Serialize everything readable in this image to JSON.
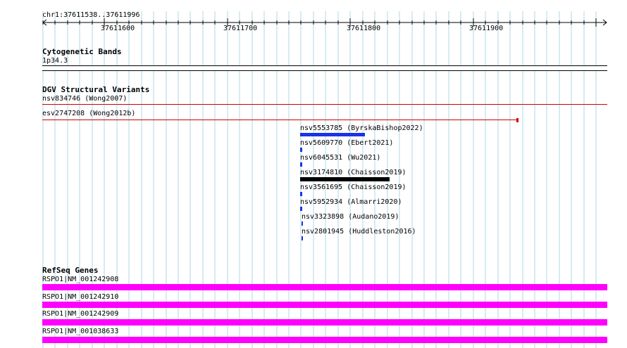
{
  "ruler": {
    "region": "chr1:37611538..37611996",
    "ticks": [
      "37611600",
      "37611700",
      "37611800",
      "37611900"
    ]
  },
  "tracks": {
    "cytobands": {
      "title": "Cytogenetic Bands",
      "band": "1p34.3"
    },
    "dgv": {
      "title": "DGV Structural Variants",
      "variants": [
        {
          "label": "nsv834746 (Wong2007)",
          "color": "#d00000"
        },
        {
          "label": "esv2747208 (Wong2012b)",
          "color": "#d00000"
        },
        {
          "label": "nsv5553785 (ByrskaBishop2022)",
          "color": "#1a33e6"
        },
        {
          "label": "nsv5609770 (Ebert2021)",
          "color": "#1a33e6"
        },
        {
          "label": "nsv6045531 (Wu2021)",
          "color": "#1a33e6"
        },
        {
          "label": "nsv3174810 (Chaisson2019)",
          "color": "#000000"
        },
        {
          "label": "nsv3561695 (Chaisson2019)",
          "color": "#1a33e6"
        },
        {
          "label": "nsv5952934 (Almarri2020)",
          "color": "#1a33e6"
        },
        {
          "label": "nsv3323898 (Audano2019)",
          "color": "#1a33e6"
        },
        {
          "label": "nsv2801945 (Huddleston2016)",
          "color": "#1a33e6"
        }
      ]
    },
    "refseq": {
      "title": "RefSeq Genes",
      "genes": [
        {
          "label": "RSPO1|NM_001242908",
          "color": "#ff00ff"
        },
        {
          "label": "RSPO1|NM_001242910",
          "color": "#ff00ff"
        },
        {
          "label": "RSPO1|NM_001242909",
          "color": "#ff00ff"
        },
        {
          "label": "RSPO1|NM_001038633",
          "color": "#ff00ff"
        }
      ]
    }
  },
  "colors": {
    "grid": "#add8e6",
    "ruler": "#000000"
  }
}
